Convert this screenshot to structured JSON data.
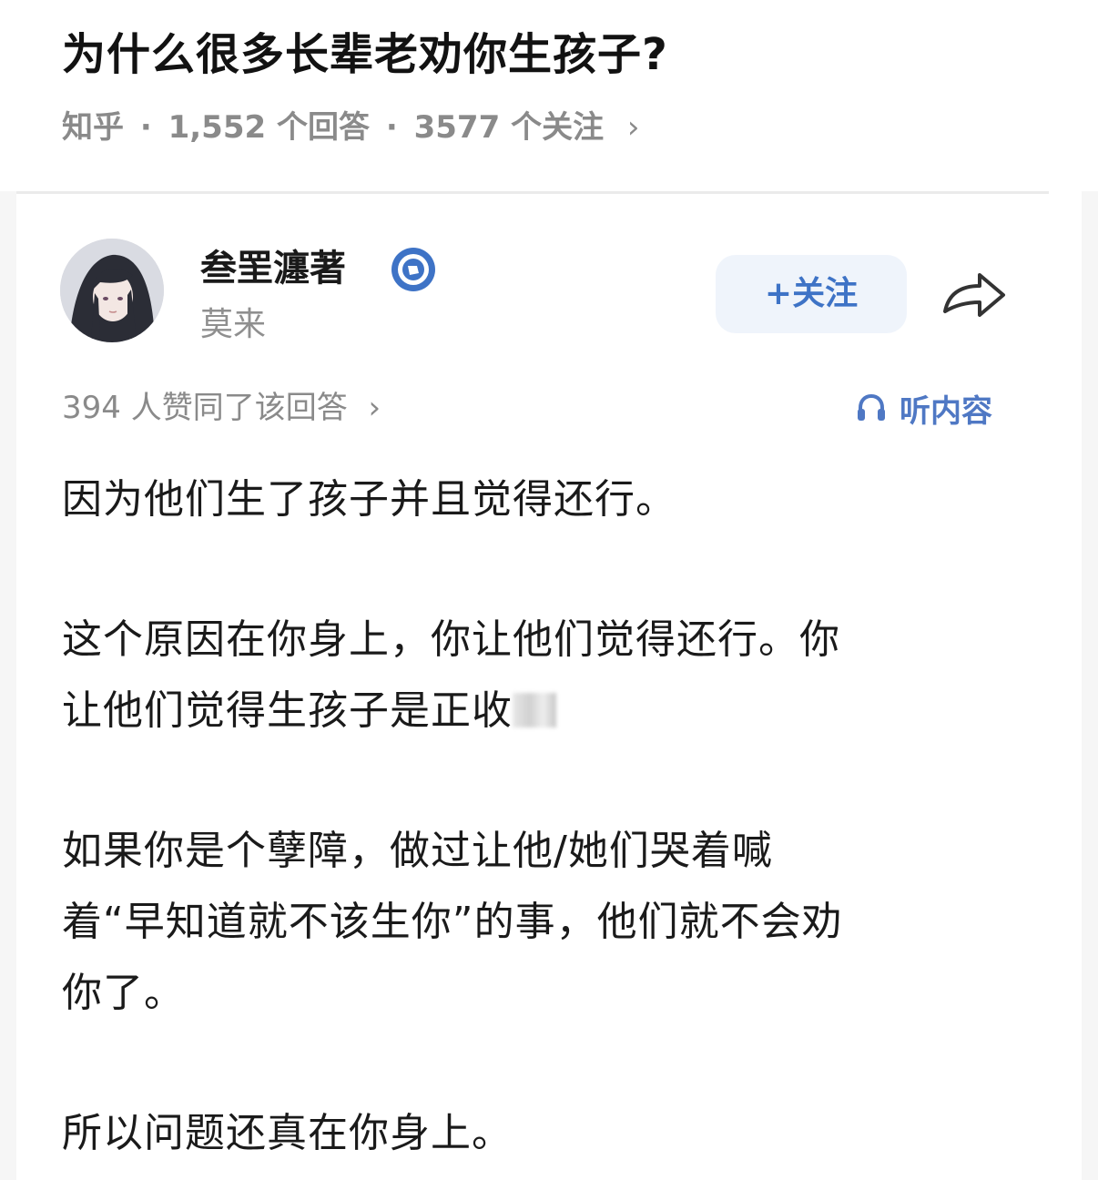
{
  "question": {
    "title": "为什么很多长辈老劝你生孩子?",
    "source": "知乎",
    "separator": "·",
    "answers": "1,552 个回答",
    "followers": "3577 个关注",
    "chevron": "›"
  },
  "author": {
    "name": "叁罜瀍著",
    "bio": "莫来",
    "verified_icon": "verified-badge-icon",
    "follow_label": "+关注",
    "share_icon": "share-arrow-icon"
  },
  "answer_meta": {
    "votes_text": "394 人赞同了该回答",
    "chevron": "›",
    "listen_label": "听内容",
    "listen_icon": "headphones-icon"
  },
  "answer": {
    "p1": "因为他们生了孩子并且觉得还行。",
    "p2_line1": "这个原因在你身上，你让他们觉得还行。你",
    "p2_line2": "让他们觉得生孩子是正收",
    "p3_line1": "如果你是个孽障，做过让他/她们哭着喊",
    "p3_line2": "着“早知道就不该生你”的事，他们就不会劝",
    "p3_line3": "你了。",
    "p4": "所以问题还真在你身上。"
  },
  "colors": {
    "accent_blue": "#3e73c6",
    "meta_gray": "#8a8a8a",
    "follow_bg": "#eff4fb"
  }
}
